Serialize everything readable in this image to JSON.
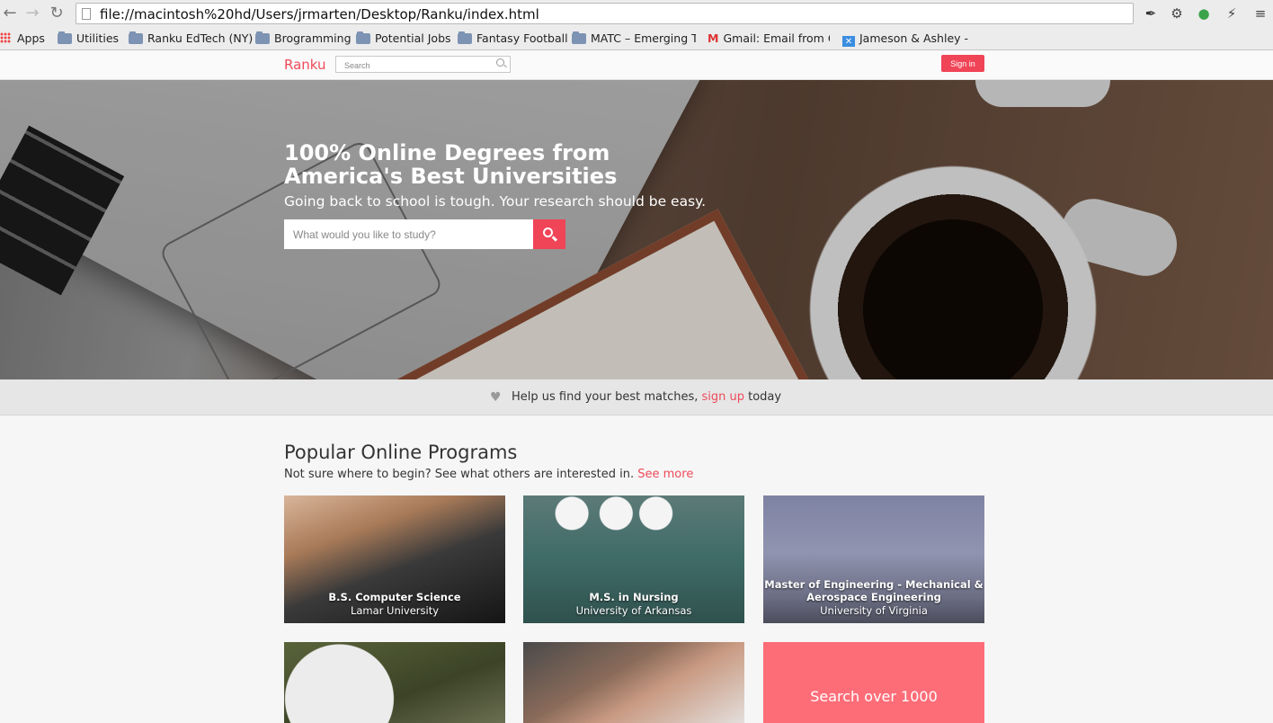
{
  "browser": {
    "url": "file://macintosh%20hd/Users/jrmarten/Desktop/Ranku/index.html",
    "bookmarks": [
      {
        "label": "Apps",
        "icon": "apps-icon"
      },
      {
        "label": "Utilities",
        "icon": "folder-icon"
      },
      {
        "label": "Ranku EdTech (NY)",
        "icon": "folder-icon"
      },
      {
        "label": "Brogramming",
        "icon": "folder-icon"
      },
      {
        "label": "Potential Jobs",
        "icon": "folder-icon"
      },
      {
        "label": "Fantasy Football",
        "icon": "folder-icon"
      },
      {
        "label": "MATC – Emerging T",
        "icon": "folder-icon"
      },
      {
        "label": "Gmail: Email from G",
        "icon": "gmail-icon"
      },
      {
        "label": "Jameson & Ashley - ",
        "icon": "jx-icon"
      }
    ]
  },
  "site": {
    "logo": "Ranku",
    "search_placeholder": "Search",
    "signin_label": "Sign in"
  },
  "hero": {
    "title": "100% Online Degrees from America's Best Universities",
    "subtitle": "Going back to school is tough. Your research should be easy.",
    "search_placeholder": "What would you like to study?"
  },
  "banner": {
    "before": "Help us find your best matches, ",
    "link": "sign up",
    "after": " today"
  },
  "programs": {
    "title": "Popular Online Programs",
    "subtitle": "Not sure where to begin? See what others are interested in.",
    "see_more": "See more",
    "cards": [
      {
        "program": "B.S. Computer Science",
        "school": "Lamar University"
      },
      {
        "program": "M.S. in Nursing",
        "school": "University of Arkansas"
      },
      {
        "program": "Master of Engineering - Mechanical & Aerospace Engineering",
        "school": "University of Virginia"
      }
    ],
    "cta": "Search over 1000"
  },
  "colors": {
    "brand": "#ef4a5a",
    "cta": "#fd6d78"
  }
}
